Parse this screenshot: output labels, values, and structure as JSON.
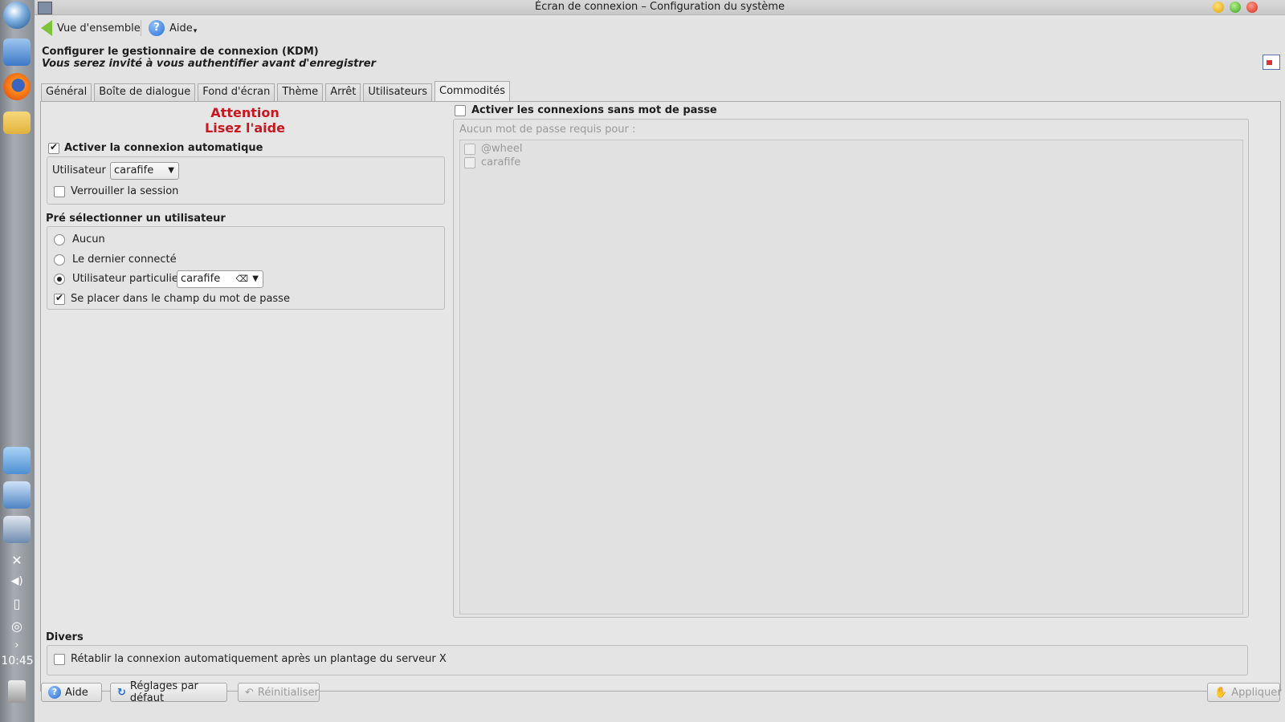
{
  "taskbar": {
    "clock": "10:45",
    "icons": [
      "kde-menu-icon",
      "file-manager-icon",
      "firefox-icon",
      "mail-icon",
      "camera-icon",
      "windows-icon",
      "settings-icon"
    ],
    "tray": [
      "tools-icon",
      "volume-icon",
      "battery-icon",
      "network-icon",
      "expand-icon",
      "trash-icon"
    ]
  },
  "window": {
    "title": "Écran de connexion – Configuration du système"
  },
  "toolbar": {
    "overview_label": "Vue d'ensemble",
    "help_label": "Aide"
  },
  "header": {
    "title": "Configurer le gestionnaire de connexion (KDM)",
    "subtitle": "Vous serez invité à vous authentifier avant d'enregistrer"
  },
  "tabs": [
    {
      "label": "Général"
    },
    {
      "label": "Boîte de dialogue"
    },
    {
      "label": "Fond d'écran"
    },
    {
      "label": "Thème"
    },
    {
      "label": "Arrêt"
    },
    {
      "label": "Utilisateurs"
    },
    {
      "label": "Commodités"
    }
  ],
  "active_tab": "Commodités",
  "left": {
    "warning_line1": "Attention",
    "warning_line2": "Lisez l'aide",
    "autologin_label": "Activer la connexion automatique",
    "autologin_checked": true,
    "user_label": "Utilisateur :",
    "user_value": "carafife",
    "lock_label": "Verrouiller la session",
    "lock_checked": false,
    "preselect_heading": "Pré sélectionner un utilisateur",
    "radio_none": "Aucun",
    "radio_last": "Le dernier connecté",
    "radio_specific": "Utilisateur particulier :",
    "radio_selected": "Utilisateur particulier :",
    "specific_value": "carafife",
    "focus_password_label": "Se placer dans le champ du mot de passe",
    "focus_password_checked": true
  },
  "right": {
    "nopass_label": "Activer les connexions sans mot de passe",
    "nopass_checked": false,
    "no_password_for": "Aucun mot de passe requis pour :",
    "items": [
      {
        "label": "@wheel",
        "checked": false
      },
      {
        "label": "carafife",
        "checked": false
      }
    ]
  },
  "misc": {
    "heading": "Divers",
    "relogin_label": "Rétablir la connexion automatiquement après un plantage du serveur X",
    "relogin_checked": false
  },
  "buttons": {
    "help": "Aide",
    "defaults": "Réglages par défaut",
    "reset": "Réinitialiser",
    "apply": "Appliquer"
  },
  "colors": {
    "warning": "#c8171e",
    "background": "#e3e3e3"
  }
}
